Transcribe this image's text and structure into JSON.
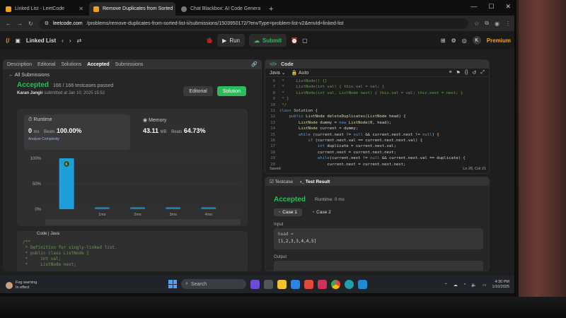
{
  "browser": {
    "tabs": [
      {
        "title": "Linked List - LeetCode",
        "active": false
      },
      {
        "title": "Remove Duplicates from Sorted",
        "active": true
      },
      {
        "title": "Chat Blackbox: AI Code Genera",
        "active": false
      }
    ],
    "new_tab": "+",
    "url_host": "leetcode.com",
    "url_path": "/problems/remove-duplicates-from-sorted-list-ii/submissions/1503950172/?envType=problem-list-v2&envId=linked-list"
  },
  "lc_top": {
    "list_label": "Linked List",
    "run_label": "Run",
    "submit_label": "Submit",
    "premium_label": "Premium",
    "avatar_letter": "K"
  },
  "left_panel": {
    "tabs": [
      "Description",
      "Editorial",
      "Solutions",
      "Accepted",
      "Submissions"
    ],
    "all_submissions": "All Submissions",
    "status": "Accepted",
    "testcases": "166 / 166 testcases passed",
    "author": "Karan Jangir",
    "submitted": "submitted at Jan 10, 2025 15:52",
    "editorial_btn": "Editorial",
    "solution_btn": "Solution",
    "runtime": {
      "label": "Runtime",
      "value": "0",
      "unit": "ms",
      "beats_label": "Beats",
      "beats": "100.00%",
      "analyze": "Analyze Complexity"
    },
    "memory": {
      "label": "Memory",
      "value": "43.11",
      "unit": "MB",
      "beats_label": "Beats",
      "beats": "64.73%"
    },
    "code_label": "Code",
    "code_lang": "Java",
    "code_lines": [
      "/**",
      " * Definition for singly-linked list.",
      " * public class ListNode {",
      " *     int val;",
      " *     ListNode next;"
    ]
  },
  "chart_data": {
    "type": "bar",
    "categories": [
      "0ms",
      "1ms",
      "2ms",
      "3ms",
      "4ms"
    ],
    "values": [
      100,
      4,
      4,
      4,
      4
    ],
    "ylabels": [
      "100%",
      "50%",
      "0%"
    ],
    "xlabels": [
      "1ms",
      "2ms",
      "3ms",
      "4ms"
    ],
    "ylim": [
      0,
      100
    ],
    "highlight_label": "K",
    "accent": "#1e9fd8"
  },
  "editor": {
    "title": "Code",
    "language": "Java",
    "auto": "Auto",
    "lines": [
      {
        "n": "6",
        "t": " *     ListNode() {}"
      },
      {
        "n": "7",
        "t": " *     ListNode(int val) { this.val = val; }"
      },
      {
        "n": "8",
        "t": " *     ListNode(int val, ListNode next) { this.val = val; this.next = next; }"
      },
      {
        "n": "9",
        "t": " * }"
      },
      {
        "n": "10",
        "t": " */"
      },
      {
        "n": "11",
        "t": "class Solution {"
      },
      {
        "n": "12",
        "t": "    public ListNode deleteDuplicates(ListNode head) {"
      },
      {
        "n": "13",
        "t": "        ListNode dummy = new ListNode(0, head);"
      },
      {
        "n": "14",
        "t": "        ListNode current = dummy;"
      },
      {
        "n": "15",
        "t": "        while (current.next != null && current.next.next != null) {"
      },
      {
        "n": "16",
        "t": "            if (current.next.val == current.next.next.val) {"
      },
      {
        "n": "17",
        "t": "                int duplicate = current.next.val;"
      },
      {
        "n": "18",
        "t": "                current.next = current.next.next;"
      },
      {
        "n": "19",
        "t": "                while(current.next != null && current.next.val == duplicate) {"
      },
      {
        "n": "20",
        "t": "                    current.next = current.next.next;"
      }
    ],
    "saved": "Saved",
    "cursor": "Ln 26, Col 21"
  },
  "test": {
    "tab_testcase": "Testcase",
    "tab_result": "Test Result",
    "status": "Accepted",
    "runtime": "Runtime: 0 ms",
    "cases": [
      "Case 1",
      "Case 2"
    ],
    "input_label": "Input",
    "var_name": "head =",
    "input_value": "[1,2,3,3,4,4,5]",
    "output_label": "Output"
  },
  "taskbar": {
    "weather_line1": "Fog warning",
    "weather_line2": "In effect",
    "search_placeholder": "Search",
    "time": "4:30 PM",
    "date": "1/10/2025"
  },
  "colors": {
    "accepted": "#2cbb5d",
    "premium": "#ffa116",
    "bar": "#1e9fd8"
  }
}
